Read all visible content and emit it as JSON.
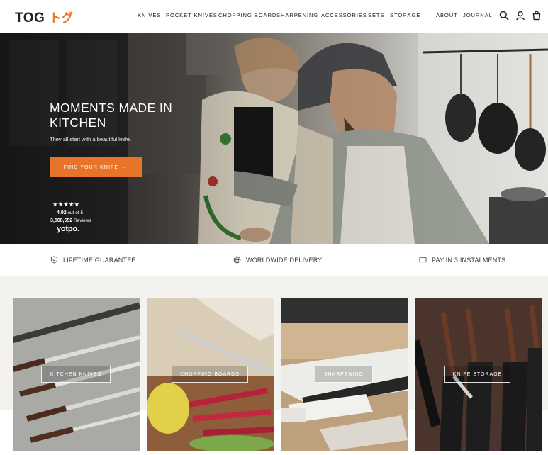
{
  "header": {
    "logo_text": "TOG",
    "logo_jp": "トグ",
    "nav": [
      "KNIVES",
      "POCKET KNIVES",
      "CHOPPING BOARD",
      "SHARPENING",
      "ACCESSORIES",
      "SETS",
      "STORAGE"
    ],
    "nav_right": [
      "ABOUT",
      "JOURNAL"
    ],
    "icons": [
      "search-icon",
      "account-icon",
      "cart-icon"
    ]
  },
  "hero": {
    "title": "MOMENTS MADE IN KITCHEN",
    "subtitle": "They all start with a beautiful knife.",
    "cta_label": "FIND YOUR KNIFE",
    "cta_arrow": "→",
    "stars": "★★★★★",
    "rating": "4.92",
    "rating_suffix": "out of 5",
    "review_count": "3,568,652",
    "review_suffix": "Reviews",
    "review_brand": "yotpo."
  },
  "benefits": [
    {
      "label": "LIFETIME GUARANTEE",
      "icon": "shield-check-icon"
    },
    {
      "label": "WORLDWIDE DELIVERY",
      "icon": "globe-icon"
    },
    {
      "label": "PAY IN 3 INSTALMENTS",
      "icon": "credit-card-icon"
    }
  ],
  "categories": [
    {
      "label": "KITCHEN KNIVES"
    },
    {
      "label": "CHOPPING BOARDS"
    },
    {
      "label": "SHARPENING"
    },
    {
      "label": "KNIFE STORAGE"
    }
  ],
  "colors": {
    "accent": "#e8742a",
    "text": "#222222",
    "section_bg": "#f4f2ef"
  }
}
